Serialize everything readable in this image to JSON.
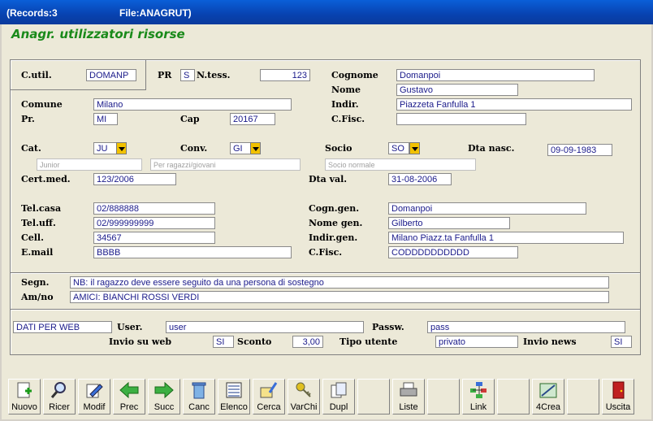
{
  "window": {
    "records": "(Records:3",
    "file": "File:ANAGRUT)"
  },
  "app_title": "Anagr. utilizzatori risorse",
  "labels": {
    "cutil": "C.util.",
    "pr": "PR",
    "ntess": "N.tess.",
    "cognome": "Cognome",
    "nome": "Nome",
    "comune": "Comune",
    "indir": "Indir.",
    "pr2": "Pr.",
    "cap": "Cap",
    "cfisc": "C.Fisc.",
    "cat": "Cat.",
    "conv": "Conv.",
    "socio": "Socio",
    "dtanasc": "Dta nasc.",
    "certmed": "Cert.med.",
    "dtaval": "Dta val.",
    "telcasa": "Tel.casa",
    "teluff": "Tel.uff.",
    "cell": "Cell.",
    "email": "E.mail",
    "cogngen": "Cogn.gen.",
    "nomegen": "Nome gen.",
    "indirgen": "Indir.gen.",
    "cfisc2": "C.Fisc.",
    "segn": "Segn.",
    "amno": "Am/no",
    "user": "User.",
    "passw": "Passw.",
    "invio_web": "Invio su web",
    "sconto": "Sconto",
    "tipo_utente": "Tipo utente",
    "invio_news": "Invio news"
  },
  "values": {
    "cutil": "DOMANP",
    "pr": "S",
    "ntess": "123",
    "cognome": "Domanpoi",
    "nome": "Gustavo",
    "comune": "Milano",
    "indir": "Piazzeta Fanfulla 1",
    "pr2": "MI",
    "cap": "20167",
    "cfisc": "",
    "cat": "JU",
    "cat_desc": "Junior",
    "conv": "GI",
    "conv_desc": "Per ragazzi/giovani",
    "socio": "SO",
    "socio_desc": "Socio normale",
    "dtanasc": "09-09-1983",
    "certmed": "123/2006",
    "dtaval": "31-08-2006",
    "telcasa": "02/888888",
    "teluff": "02/999999999",
    "cell": "34567",
    "email": "BBBB",
    "cogngen": "Domanpoi",
    "nomegen": "Gilberto",
    "indirgen": "Milano Piazz.ta Fanfulla 1",
    "cfisc2": "CODDDDDDDDDD",
    "segn": "NB: il ragazzo deve essere seguito da una persona di sostegno",
    "amno": "AMICI: BIANCHI ROSSI VERDI",
    "web_section": "DATI PER WEB",
    "user": "user",
    "passw": "pass",
    "invio_web": "SI",
    "sconto": "3,00",
    "tipo_utente": "privato",
    "invio_news": "SI"
  },
  "toolbar": [
    {
      "label": "Nuovo",
      "icon": "new-icon"
    },
    {
      "label": "Ricer",
      "icon": "search-icon"
    },
    {
      "label": "Modif",
      "icon": "edit-icon"
    },
    {
      "label": "Prec",
      "icon": "arrow-left-icon"
    },
    {
      "label": "Succ",
      "icon": "arrow-right-icon"
    },
    {
      "label": "Canc",
      "icon": "trash-icon"
    },
    {
      "label": "Elenco",
      "icon": "list-icon"
    },
    {
      "label": "Cerca",
      "icon": "find-icon"
    },
    {
      "label": "VarChi",
      "icon": "keys-icon"
    },
    {
      "label": "Dupl",
      "icon": "duplicate-icon"
    },
    {
      "label": "",
      "icon": ""
    },
    {
      "label": "Liste",
      "icon": "printer-icon"
    },
    {
      "label": "",
      "icon": ""
    },
    {
      "label": "Link",
      "icon": "link-tree-icon"
    },
    {
      "label": "",
      "icon": ""
    },
    {
      "label": "4Crea",
      "icon": "create-icon"
    },
    {
      "label": "",
      "icon": ""
    },
    {
      "label": "Uscita",
      "icon": "exit-door-icon"
    }
  ],
  "colors": {
    "title_green": "#1a8a1a",
    "field_text": "#1a1a8a",
    "dropdown": "#f2c200"
  }
}
